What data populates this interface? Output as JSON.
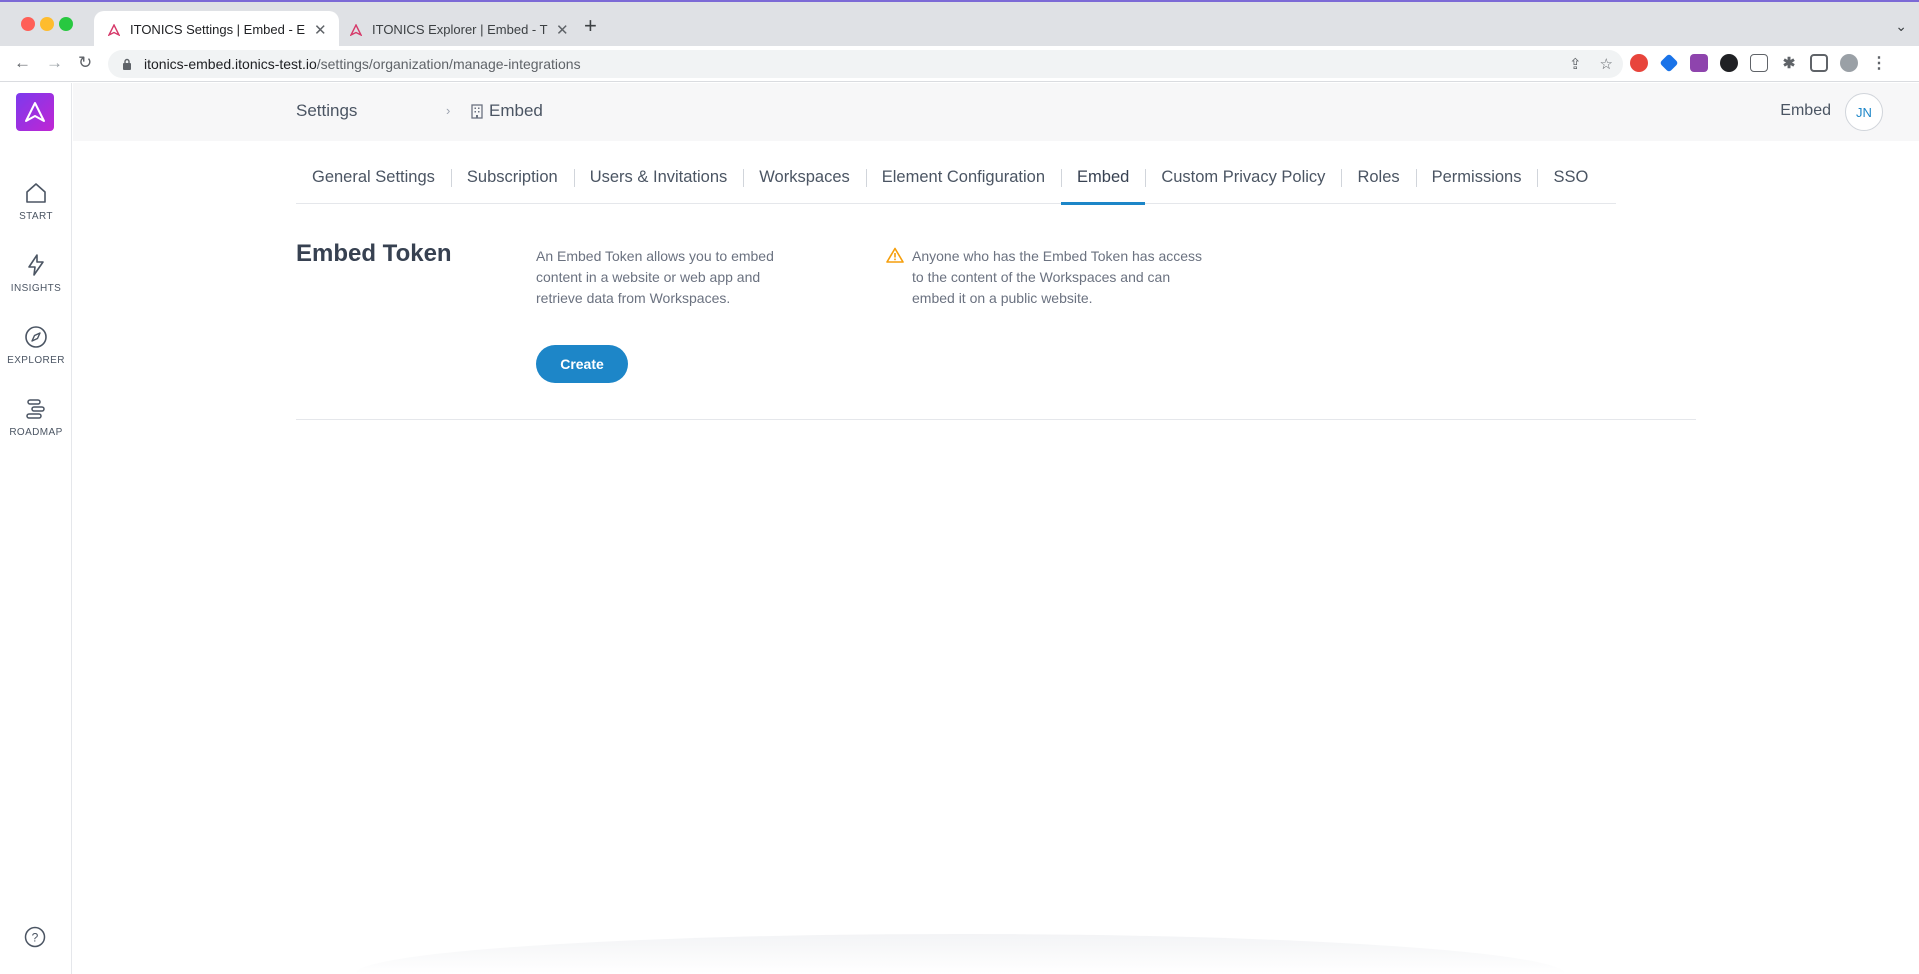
{
  "browser": {
    "tabs": [
      {
        "title": "ITONICS Settings | Embed - Em",
        "active": true
      },
      {
        "title": "ITONICS Explorer | Embed - Tre",
        "active": false
      }
    ],
    "url_host": "itonics-embed.itonics-test.io",
    "url_path": "/settings/organization/manage-integrations"
  },
  "sidebar": {
    "items": [
      {
        "label": "START",
        "icon": "home-icon"
      },
      {
        "label": "INSIGHTS",
        "icon": "lightning-icon"
      },
      {
        "label": "EXPLORER",
        "icon": "compass-icon"
      },
      {
        "label": "ROADMAP",
        "icon": "roadmap-icon"
      }
    ],
    "help_icon": "help-icon"
  },
  "header": {
    "breadcrumb_root": "Settings",
    "breadcrumb_current": "Embed",
    "user_name": "Embed",
    "avatar_initials": "JN"
  },
  "settings_tabs": [
    {
      "label": "General Settings",
      "active": false
    },
    {
      "label": "Subscription",
      "active": false
    },
    {
      "label": "Users & Invitations",
      "active": false
    },
    {
      "label": "Workspaces",
      "active": false
    },
    {
      "label": "Element Configuration",
      "active": false
    },
    {
      "label": "Embed",
      "active": true
    },
    {
      "label": "Custom Privacy Policy",
      "active": false
    },
    {
      "label": "Roles",
      "active": false
    },
    {
      "label": "Permissions",
      "active": false
    },
    {
      "label": "SSO",
      "active": false
    }
  ],
  "embed_token": {
    "title": "Embed Token",
    "description": "An Embed Token allows you to embed content in a website or web app and retrieve data from Workspaces.",
    "warning": "Anyone who has the Embed Token has access to the content of the Workspaces and can embed it on a public website.",
    "create_label": "Create"
  },
  "colors": {
    "accent": "#1d86c8",
    "logo_start": "#7c3aed",
    "logo_end": "#c026d3",
    "warning": "#f59e0b"
  }
}
